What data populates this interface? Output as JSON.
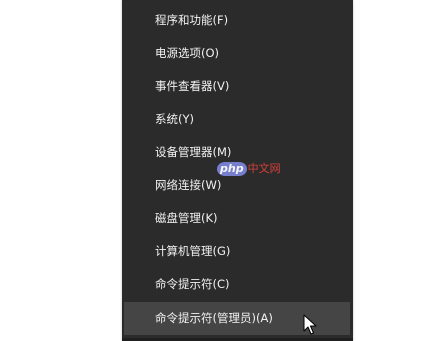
{
  "menu": {
    "items": [
      {
        "label": "程序和功能(F)"
      },
      {
        "label": "电源选项(O)"
      },
      {
        "label": "事件查看器(V)"
      },
      {
        "label": "系统(Y)"
      },
      {
        "label": "设备管理器(M)"
      },
      {
        "label": "网络连接(W)"
      },
      {
        "label": "磁盘管理(K)"
      },
      {
        "label": "计算机管理(G)"
      },
      {
        "label": "命令提示符(C)"
      },
      {
        "label": "命令提示符(管理员)(A)"
      }
    ],
    "highlighted_index": 9
  },
  "watermark": {
    "badge": "php",
    "text": "中文网"
  }
}
